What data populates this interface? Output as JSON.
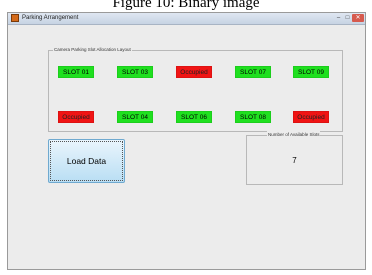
{
  "caption": "Figure 10: Binary image",
  "window": {
    "title": "Parking Arrangement",
    "minimize_glyph": "–",
    "maximize_glyph": "□",
    "close_glyph": "✕"
  },
  "layout_panel": {
    "title": "Camera Parking Slot Allocation Layout",
    "slots": [
      {
        "label": "SLOT 01",
        "status": "free"
      },
      {
        "label": "SLOT 03",
        "status": "free"
      },
      {
        "label": "Occupied",
        "status": "occupied"
      },
      {
        "label": "SLOT 07",
        "status": "free"
      },
      {
        "label": "SLOT 09",
        "status": "free"
      },
      {
        "label": "Occupied",
        "status": "occupied"
      },
      {
        "label": "SLOT 04",
        "status": "free"
      },
      {
        "label": "SLOT 06",
        "status": "free"
      },
      {
        "label": "SLOT 08",
        "status": "free"
      },
      {
        "label": "Occupied",
        "status": "occupied"
      }
    ]
  },
  "load_button": {
    "label": "Load Data"
  },
  "available_panel": {
    "title": "Number of Available Slots",
    "value": "7"
  },
  "colors": {
    "free": "#1fe01f",
    "occupied": "#f01414",
    "button": "#b9def4"
  }
}
